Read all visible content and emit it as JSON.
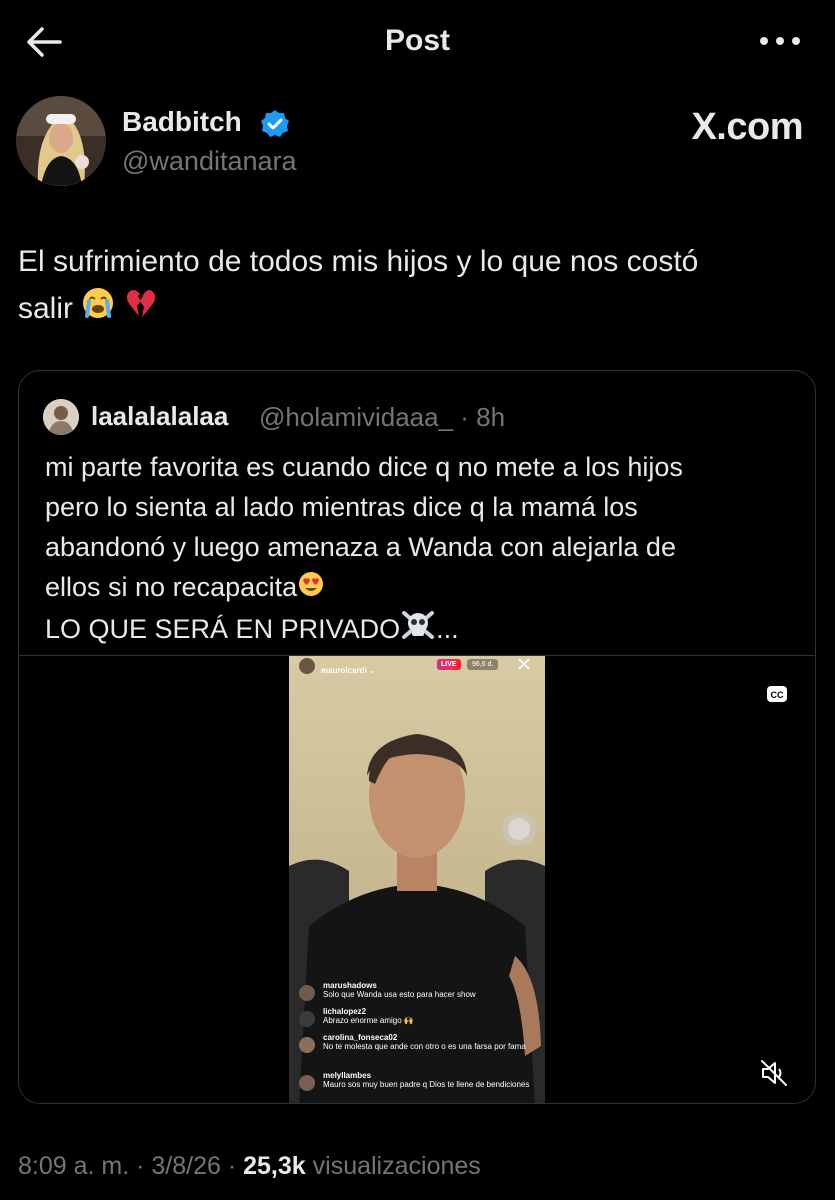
{
  "header": {
    "title": "Post",
    "back_icon": "arrow-left-icon",
    "more_icon": "more-horizontal-icon"
  },
  "author": {
    "name": "Badbitch",
    "handle": "@wanditanara",
    "verified_color": "#1d9bf0"
  },
  "watermark": "X.com",
  "post": {
    "text_line1": "El sufrimiento de todos mis hijos y lo que nos costó",
    "text_line2": "salir",
    "emojis": [
      "loudly-crying-face",
      "broken-heart"
    ]
  },
  "quote": {
    "name": "laalalalalaa",
    "handle": "@holamividaaa_ · 8h",
    "lines": [
      "mi parte favorita es cuando dice q no mete a los hijos",
      "pero lo sienta al lado mientras dice q la mamá los",
      "abandonó y luego amenaza a Wanda con alejarla de",
      "ellos si no recapacita"
    ],
    "last_line": "LO QUE SERÁ EN PRIVADO",
    "ellipsis": "..."
  },
  "video": {
    "ig_user": "mauroicardi",
    "live_badge": "LIVE",
    "viewers": "96,6 d.",
    "comments": [
      {
        "user": "marushadows",
        "text": "Solo que Wanda usa esto para hacer show"
      },
      {
        "user": "lichalopez2",
        "text": "Abrazo enorme amigo 🙌"
      },
      {
        "user": "carolina_fonseca02",
        "text": "No te molesta que ande con otro o es una farsa por fama"
      },
      {
        "user": "melyllambes",
        "text": "Mauro sos muy buen padre q Dios te llene de bendiciones"
      }
    ],
    "cc_icon": "closed-captions-icon",
    "mute_icon": "volume-muted-icon"
  },
  "meta": {
    "time": "8:09 a. m.",
    "date": "3/8/26",
    "views_count": "25,3k",
    "views_label": "visualizaciones"
  }
}
